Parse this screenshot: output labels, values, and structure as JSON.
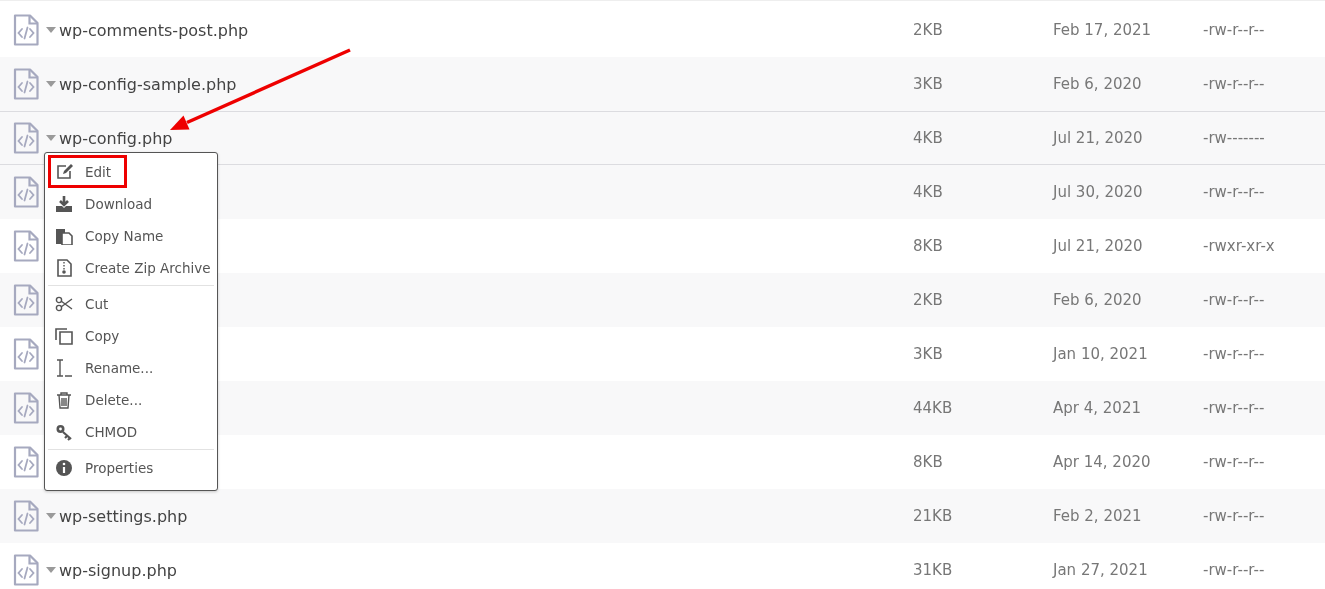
{
  "files": [
    {
      "name": "wp-comments-post.php",
      "size": "2KB",
      "date": "Feb 17, 2021",
      "permissions": "-rw-r--r--",
      "selected": false
    },
    {
      "name": "wp-config-sample.php",
      "size": "3KB",
      "date": "Feb 6, 2020",
      "permissions": "-rw-r--r--",
      "selected": false
    },
    {
      "name": "wp-config.php",
      "size": "4KB",
      "date": "Jul 21, 2020",
      "permissions": "-rw-------",
      "selected": true
    },
    {
      "size": "4KB",
      "date": "Jul 30, 2020",
      "permissions": "-rw-r--r--",
      "selected": false
    },
    {
      "size": "8KB",
      "date": "Jul 21, 2020",
      "permissions": "-rwxr-xr-x",
      "selected": false
    },
    {
      "size": "2KB",
      "date": "Feb 6, 2020",
      "permissions": "-rw-r--r--",
      "selected": false
    },
    {
      "size": "3KB",
      "date": "Jan 10, 2021",
      "permissions": "-rw-r--r--",
      "selected": false
    },
    {
      "size": "44KB",
      "date": "Apr 4, 2021",
      "permissions": "-rw-r--r--",
      "selected": false
    },
    {
      "size": "8KB",
      "date": "Apr 14, 2020",
      "permissions": "-rw-r--r--",
      "selected": false
    },
    {
      "name": "wp-settings.php",
      "size": "21KB",
      "date": "Feb 2, 2021",
      "permissions": "-rw-r--r--",
      "selected": false
    },
    {
      "name": "wp-signup.php",
      "size": "31KB",
      "date": "Jan 27, 2021",
      "permissions": "-rw-r--r--",
      "selected": false
    }
  ],
  "context_menu": {
    "items": [
      {
        "kind": "item",
        "label": "Edit",
        "outlined": true
      },
      {
        "kind": "item",
        "label": "Download",
        "outlined": false
      },
      {
        "kind": "item",
        "label": "Copy Name",
        "outlined": false
      },
      {
        "kind": "item",
        "label": "Create Zip Archive",
        "outlined": false
      },
      {
        "kind": "separator"
      },
      {
        "kind": "item",
        "label": "Cut",
        "outlined": false
      },
      {
        "kind": "item",
        "label": "Copy",
        "outlined": false
      },
      {
        "kind": "item",
        "label": "Rename...",
        "outlined": false
      },
      {
        "kind": "item",
        "label": "Delete...",
        "outlined": false
      },
      {
        "kind": "item",
        "label": "CHMOD",
        "outlined": false
      },
      {
        "kind": "separator"
      },
      {
        "kind": "item",
        "label": "Properties",
        "outlined": false
      }
    ]
  },
  "annotations": [
    {
      "kind": "arrow"
    }
  ]
}
